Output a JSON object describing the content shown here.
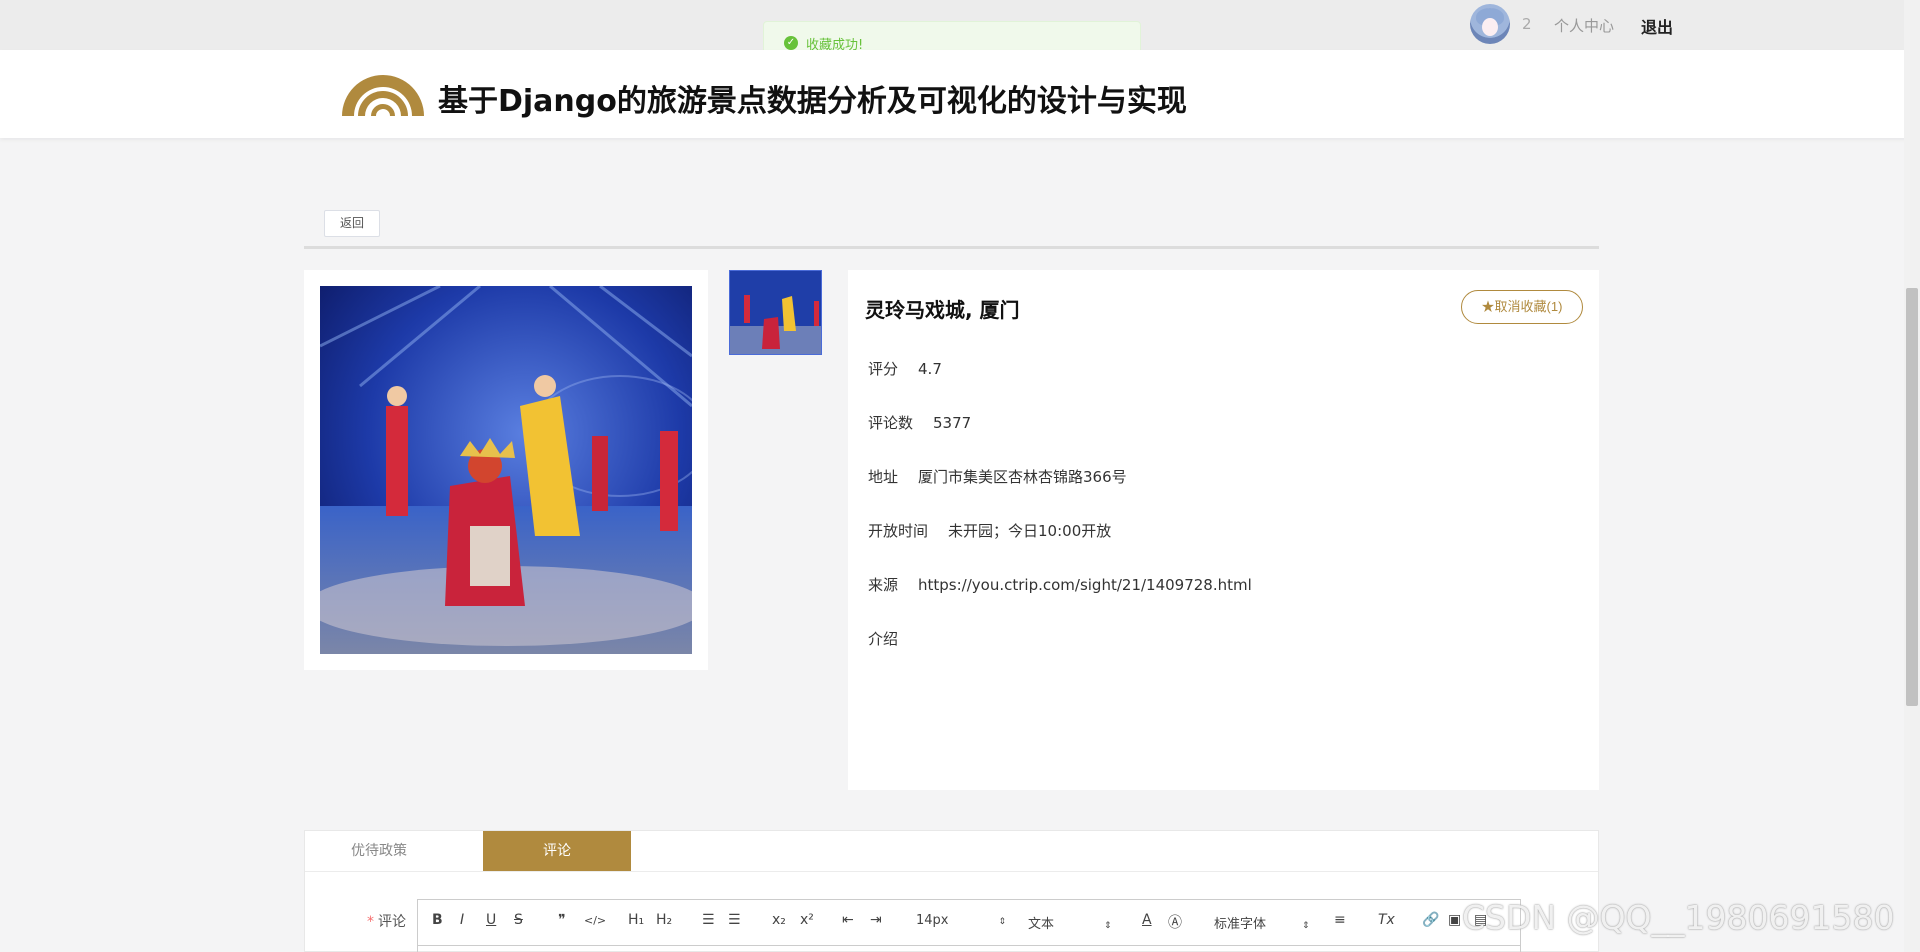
{
  "topbar": {
    "user_number": "2",
    "user_center": "个人中心",
    "logout": "退出"
  },
  "toast": {
    "message": "收藏成功!",
    "icon": "check-icon"
  },
  "header": {
    "title": "基于Django的旅游景点数据分析及可视化的设计与实现"
  },
  "back_label": "返回",
  "sight": {
    "name": "灵玲马戏城, 厦门",
    "fav_label": "★取消收藏(1)",
    "fields": [
      {
        "key": "评分",
        "value": "4.7"
      },
      {
        "key": "评论数",
        "value": "5377"
      },
      {
        "key": "地址",
        "value": "厦门市集美区杏林杏锦路366号"
      },
      {
        "key": "开放时间",
        "value": "未开园；今日10:00开放"
      },
      {
        "key": "来源",
        "value": "https://you.ctrip.com/sight/21/1409728.html"
      },
      {
        "key": "介绍",
        "value": ""
      }
    ]
  },
  "tabs": [
    {
      "label": "优待政策",
      "active": false
    },
    {
      "label": "评论",
      "active": true
    }
  ],
  "comment": {
    "required_mark": "*",
    "label": "评论"
  },
  "editor_toolbar": {
    "bold": "B",
    "italic": "I",
    "underline": "U",
    "strike": "S",
    "quote": "❞",
    "code": "</>",
    "h1": "H₁",
    "h2": "H₂",
    "subscript": "x₂",
    "superscript": "x²",
    "size": "14px",
    "format": "文本",
    "font": "标准字体",
    "clear": "Tx"
  },
  "watermark": "CSDN @QQ__1980691580",
  "colors": {
    "accent": "#b08a3e",
    "success": "#67c23a"
  }
}
